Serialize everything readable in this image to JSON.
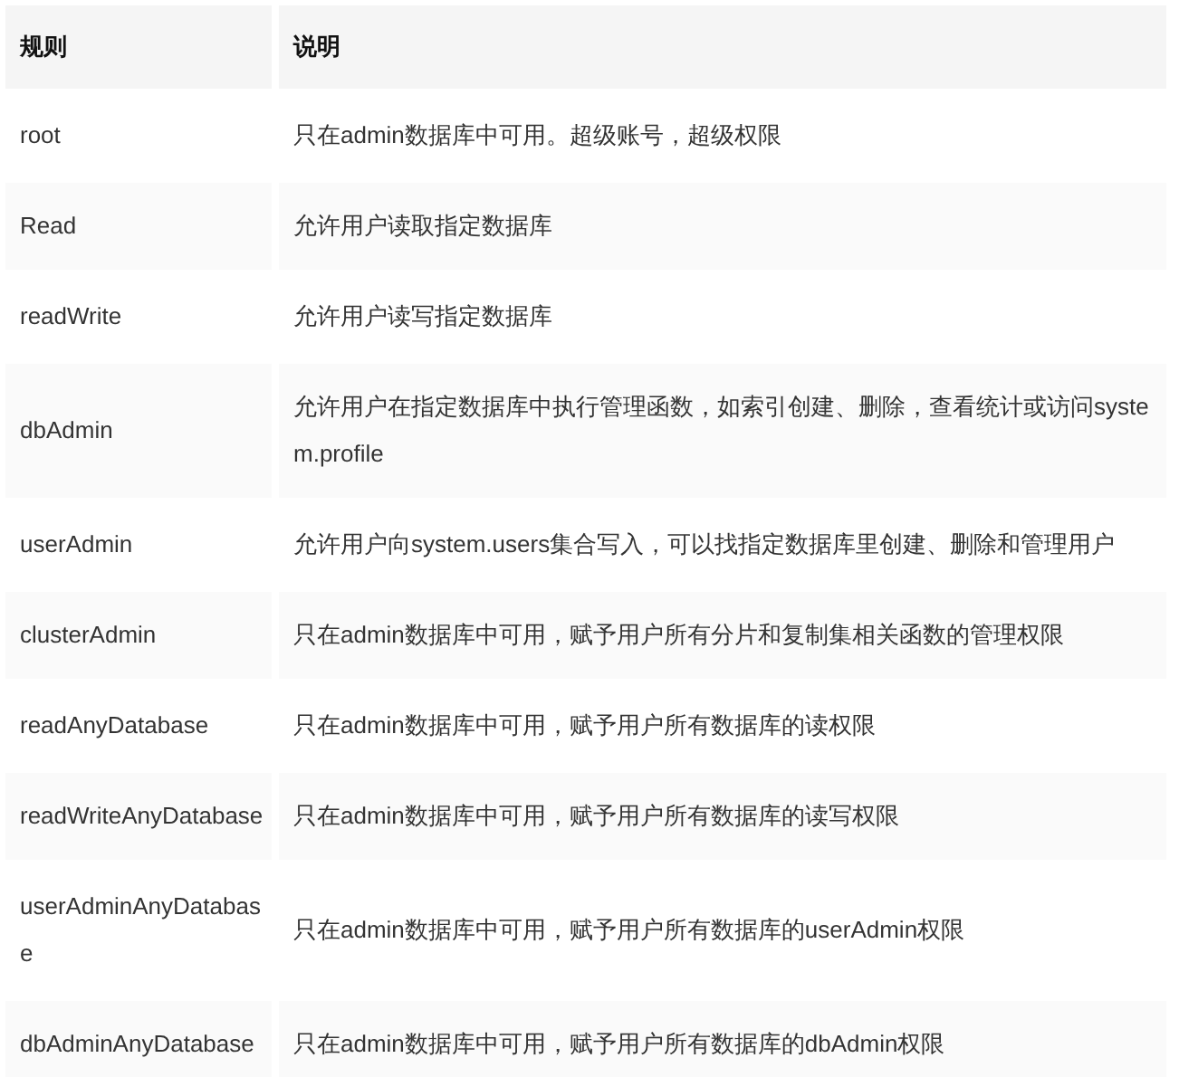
{
  "table": {
    "columns": [
      "规则",
      "说明"
    ],
    "rows": [
      [
        "root",
        "只在admin数据库中可用。超级账号，超级权限"
      ],
      [
        "Read",
        "允许用户读取指定数据库"
      ],
      [
        "readWrite",
        "允许用户读写指定数据库"
      ],
      [
        "dbAdmin",
        "允许用户在指定数据库中执行管理函数，如索引创建、删除，查看统计或访问system.profile"
      ],
      [
        "userAdmin",
        "允许用户向system.users集合写入，可以找指定数据库里创建、删除和管理用户"
      ],
      [
        "clusterAdmin",
        "只在admin数据库中可用，赋予用户所有分片和复制集相关函数的管理权限"
      ],
      [
        "readAnyDatabase",
        "只在admin数据库中可用，赋予用户所有数据库的读权限"
      ],
      [
        "readWriteAnyDatabase",
        "只在admin数据库中可用，赋予用户所有数据库的读写权限"
      ],
      [
        "userAdminAnyDatabase",
        "只在admin数据库中可用，赋予用户所有数据库的userAdmin权限"
      ],
      [
        "dbAdminAnyDatabase",
        "只在admin数据库中可用，赋予用户所有数据库的dbAdmin权限"
      ]
    ]
  }
}
